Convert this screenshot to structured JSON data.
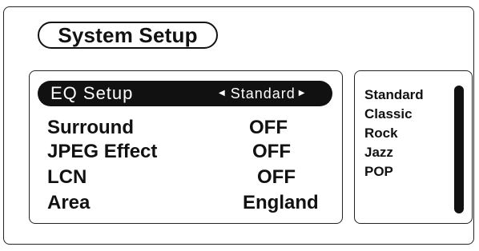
{
  "title": "System Setup",
  "menu": {
    "selected": {
      "label": "EQ Setup",
      "value": "Standard"
    },
    "items": [
      {
        "label": "Surround",
        "value": "OFF"
      },
      {
        "label": "JPEG Effect",
        "value": "OFF"
      },
      {
        "label": "LCN",
        "value": "OFF"
      },
      {
        "label": "Area",
        "value": "England"
      }
    ]
  },
  "options": [
    "Standard",
    "Classic",
    "Rock",
    "Jazz",
    "POP"
  ],
  "icons": {
    "left": "arrow-left-icon",
    "right": "arrow-right-icon"
  },
  "colors": {
    "foreground": "#111111",
    "background": "#ffffff",
    "highlight": "#111111"
  }
}
